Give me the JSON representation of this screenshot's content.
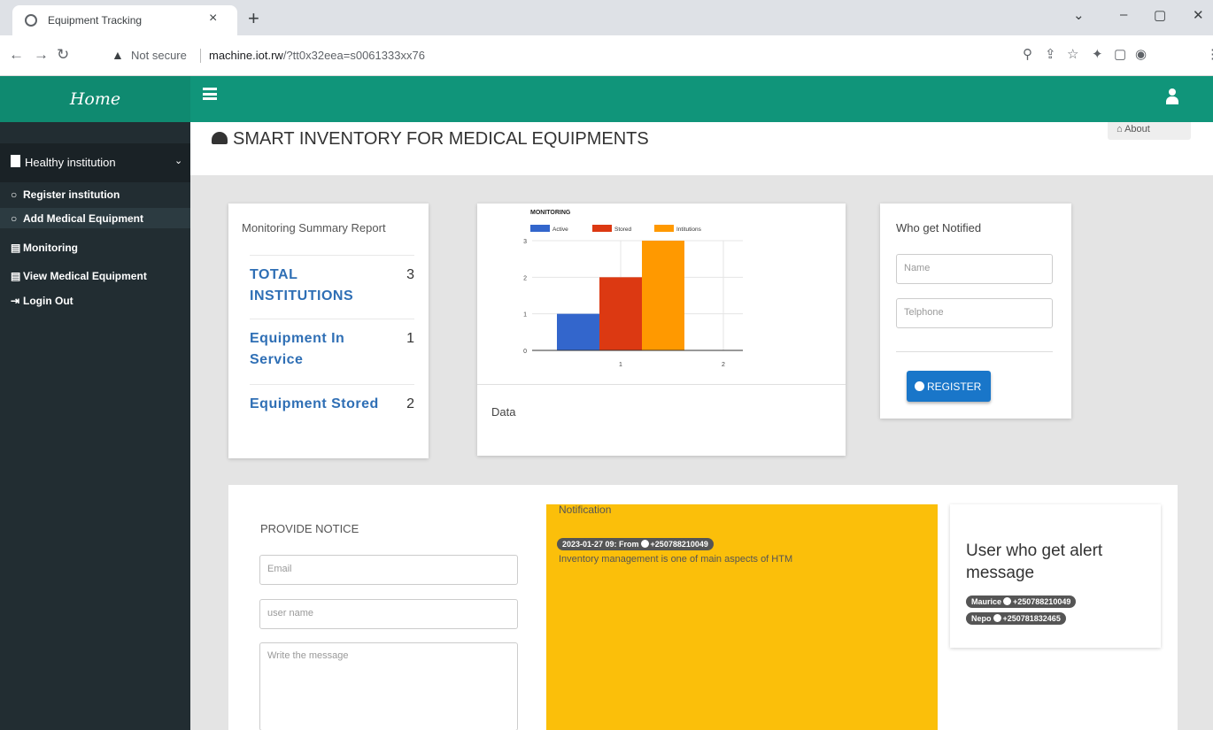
{
  "browser": {
    "tab_title": "Equipment Tracking",
    "tab_close": "×",
    "new_tab": "+",
    "not_secure": "Not secure",
    "url_host": "machine.iot.rw",
    "url_path": "/?tt0x32eea=s0061333xx76",
    "window_controls": [
      "⌄",
      "–",
      "▢",
      "✕"
    ]
  },
  "header": {
    "brand": "Home"
  },
  "sidebar": {
    "group_label": "Healthy institution",
    "items": [
      {
        "label": "Register institution",
        "icon": "circle-icon"
      },
      {
        "label": "Add Medical Equipment",
        "icon": "circle-icon"
      },
      {
        "label": "Monitoring",
        "icon": "table-icon"
      },
      {
        "label": "View Medical Equipment",
        "icon": "table-icon"
      },
      {
        "label": "Login Out",
        "icon": "logout-icon"
      }
    ]
  },
  "page": {
    "title": "SMART INVENTORY FOR MEDICAL EQUIPMENTS",
    "breadcrumb": "About"
  },
  "summary": {
    "title": "Monitoring Summary Report",
    "rows": [
      {
        "key_line1": "TOTAL",
        "key_line2": "INSTITUTIONS",
        "value": "3"
      },
      {
        "key_line1": "Equipment In",
        "key_line2": "Service",
        "value": "1"
      },
      {
        "key_line1": "Equipment Stored",
        "key_line2": "",
        "value": "2"
      }
    ]
  },
  "chart_card": {
    "data_label": "Data"
  },
  "chart_data": {
    "type": "bar",
    "title": "MONITORING",
    "categories": [
      "1",
      "2"
    ],
    "series": [
      {
        "name": "Active",
        "values": [
          1,
          null
        ],
        "color": "#3366cc"
      },
      {
        "name": "Stored",
        "values": [
          2,
          null
        ],
        "color": "#dc3912"
      },
      {
        "name": "Intitutions",
        "values": [
          3,
          null
        ],
        "color": "#ff9900"
      }
    ],
    "ylim": [
      0,
      3
    ],
    "yticks": [
      "0",
      "1",
      "2",
      "3"
    ],
    "grid": true,
    "legend": "top"
  },
  "notify": {
    "title": "Who get Notified",
    "name_placeholder": "Name",
    "phone_placeholder": "Telphone",
    "register_label": "REGISTER"
  },
  "notice": {
    "title": "PROVIDE NOTICE",
    "email_placeholder": "Email",
    "username_placeholder": "user name",
    "message_placeholder": "Write the message"
  },
  "notification": {
    "title": "Notification",
    "badge_prefix": "2023-01-27 09: From",
    "badge_phone": "+250788210049",
    "message": "Inventory management is one of main aspects of HTM"
  },
  "alert_users": {
    "title": "User who get alert message",
    "users": [
      {
        "name": "Maurice",
        "phone": "+250788210049"
      },
      {
        "name": "Nepo",
        "phone": "+250781832465"
      }
    ]
  },
  "colors": {
    "header_green": "#10957a",
    "sidebar_dark": "#222d32",
    "notification_yellow": "#fbbf0a",
    "register_blue": "#1976c9"
  }
}
